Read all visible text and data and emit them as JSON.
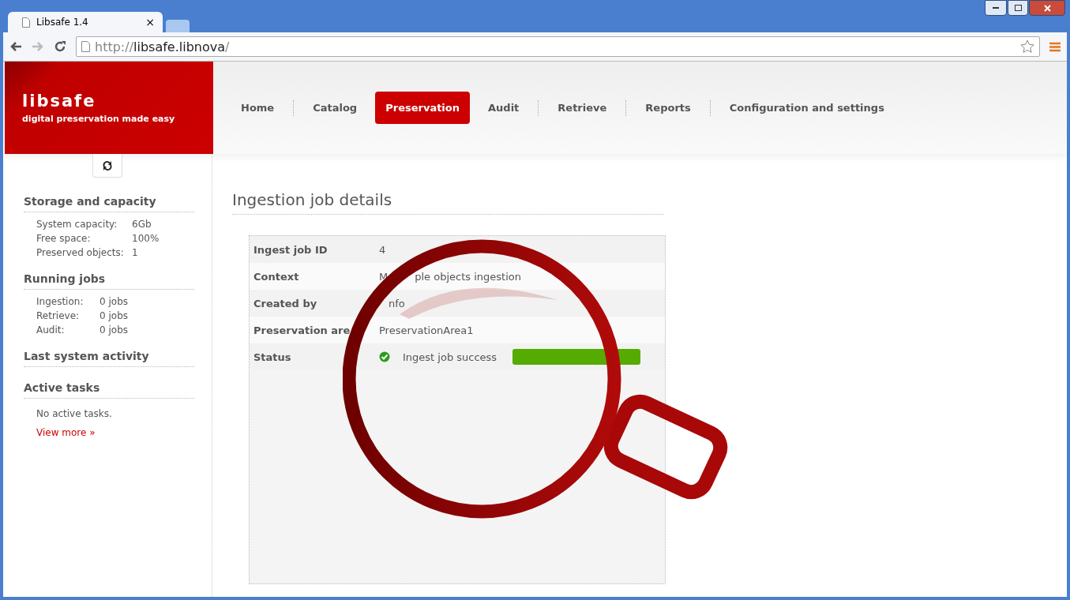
{
  "browser": {
    "tab_title": "Libsafe 1.4",
    "tab_close": "×",
    "url_scheme": "http://",
    "url_host": "libsafe.libnova",
    "url_path": "/"
  },
  "header": {
    "logo": "libsafe",
    "tagline": "digital preservation made easy"
  },
  "nav": [
    {
      "label": "Home",
      "selected": false
    },
    {
      "label": "Catalog",
      "selected": false
    },
    {
      "label": "Preservation",
      "selected": true
    },
    {
      "label": "Audit",
      "selected": false
    },
    {
      "label": "Retrieve",
      "selected": false
    },
    {
      "label": "Reports",
      "selected": false
    },
    {
      "label": "Configuration and settings",
      "selected": false
    }
  ],
  "sidebar": [
    {
      "title": "Storage and capacity",
      "rows": [
        {
          "label": "System capacity:",
          "value": "6Gb"
        },
        {
          "label": "Free space:",
          "value": "100%"
        },
        {
          "label": "Preserved objects:",
          "value": "1"
        }
      ]
    },
    {
      "title": "Running jobs",
      "rows": [
        {
          "label": "Ingestion:",
          "value": "0 jobs"
        },
        {
          "label": "Retrieve:",
          "value": "0 jobs"
        },
        {
          "label": "Audit:",
          "value": "0 jobs"
        }
      ]
    },
    {
      "title": "Last system activity"
    },
    {
      "title": "Active tasks",
      "note": "No active tasks.",
      "link": "View more »"
    }
  ],
  "main": {
    "title": "Ingestion job details",
    "rows": [
      {
        "label": "Ingest job ID",
        "value": "4",
        "kind": "text"
      },
      {
        "label": "Context",
        "value_parts": [
          "M",
          "ple objects ingestion"
        ],
        "kind": "split"
      },
      {
        "label": "Created by",
        "value": "nfo",
        "kind": "tail"
      },
      {
        "label": "Preservation are",
        "value": "PreservationArea1",
        "kind": "text"
      },
      {
        "label": "Status",
        "value": "Ingest job success",
        "kind": "status",
        "level": 1
      }
    ]
  }
}
